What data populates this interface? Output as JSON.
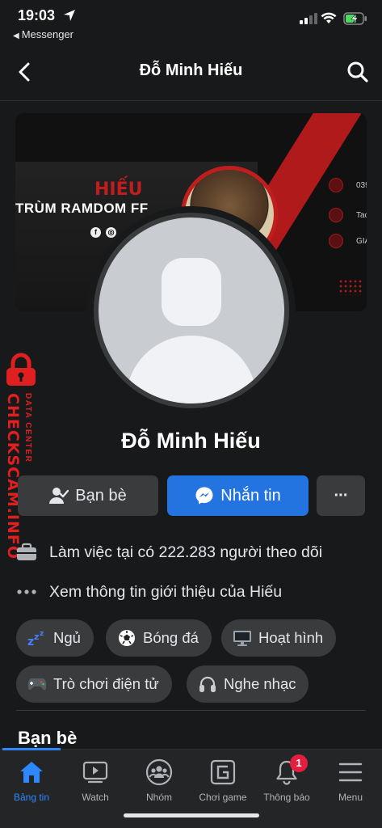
{
  "status_bar": {
    "time": "19:03",
    "back_app": "Messenger"
  },
  "topbar": {
    "title": "Đỗ Minh Hiếu"
  },
  "cover": {
    "heading": "HIẾU",
    "subheading": "TRÙM RAMDOM FF",
    "contacts": [
      "039",
      "Tao",
      "GIA"
    ]
  },
  "watermark": {
    "big": "CHECKSCAM.INFO",
    "small": "DATA CENTER"
  },
  "profile": {
    "name": "Đỗ Minh Hiếu"
  },
  "actions": {
    "friends_label": "Bạn bè",
    "message_label": "Nhắn tin",
    "more_label": "···"
  },
  "info": {
    "work": "Làm việc tại có 222.283 người theo dõi",
    "about": "Xem thông tin giới thiệu của Hiếu"
  },
  "hobbies": [
    {
      "label": "Ngủ",
      "icon": "sleep-icon"
    },
    {
      "label": "Bóng đá",
      "icon": "soccer-ball-icon"
    },
    {
      "label": "Hoạt hình",
      "icon": "tv-icon"
    },
    {
      "label": "Trò chơi điện tử",
      "icon": "gamepad-icon"
    },
    {
      "label": "Nghe nhạc",
      "icon": "headphones-icon"
    }
  ],
  "friends_section": {
    "title": "Bạn bè"
  },
  "bottom_nav": [
    {
      "label": "Bảng tin",
      "icon": "home-icon",
      "active": true
    },
    {
      "label": "Watch",
      "icon": "watch-icon"
    },
    {
      "label": "Nhóm",
      "icon": "groups-icon"
    },
    {
      "label": "Chơi game",
      "icon": "gaming-icon"
    },
    {
      "label": "Thông báo",
      "icon": "bell-icon",
      "badge": "1"
    },
    {
      "label": "Menu",
      "icon": "menu-icon"
    }
  ],
  "colors": {
    "background": "#18191a",
    "surface": "#3a3b3c",
    "accent": "#2374e1",
    "nav_active": "#2d88ff",
    "badge": "#e41e3f",
    "watermark": "#e02020"
  }
}
